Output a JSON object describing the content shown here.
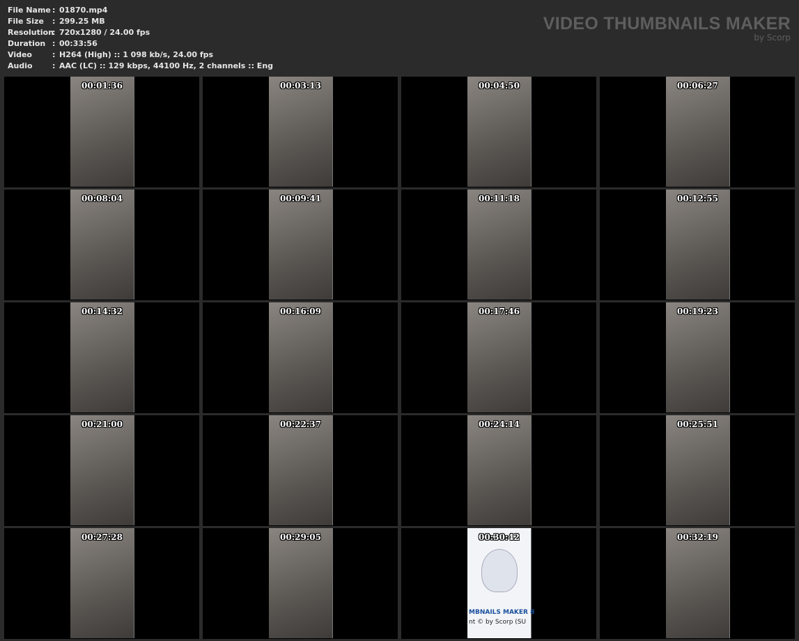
{
  "meta": [
    {
      "key": "File Name",
      "value": "01870.mp4"
    },
    {
      "key": "File Size",
      "value": "299.25 MB"
    },
    {
      "key": "Resolution",
      "value": "720x1280 / 24.00 fps"
    },
    {
      "key": "Duration",
      "value": "00:33:56"
    },
    {
      "key": "Video",
      "value": "H264 (High) :: 1 098 kb/s, 24.00 fps"
    },
    {
      "key": "Audio",
      "value": "AAC (LC) :: 129 kbps, 44100 Hz, 2 channels :: Eng"
    }
  ],
  "brand": {
    "title": "VIDEO THUMBNAILS MAKER",
    "subtitle": "by Scorp"
  },
  "separator": ":",
  "timestamps": [
    "00:01:36",
    "00:03:13",
    "00:04:50",
    "00:06:27",
    "00:08:04",
    "00:09:41",
    "00:11:18",
    "00:12:55",
    "00:14:32",
    "00:16:09",
    "00:17:46",
    "00:19:23",
    "00:21:00",
    "00:22:37",
    "00:24:14",
    "00:25:51",
    "00:27:28",
    "00:29:05",
    "00:30:42",
    "00:32:19"
  ],
  "logo_frame": {
    "index": 18,
    "line1": "MBNAILS MAKER 8",
    "line2": "nt © by Scorp (SU"
  }
}
